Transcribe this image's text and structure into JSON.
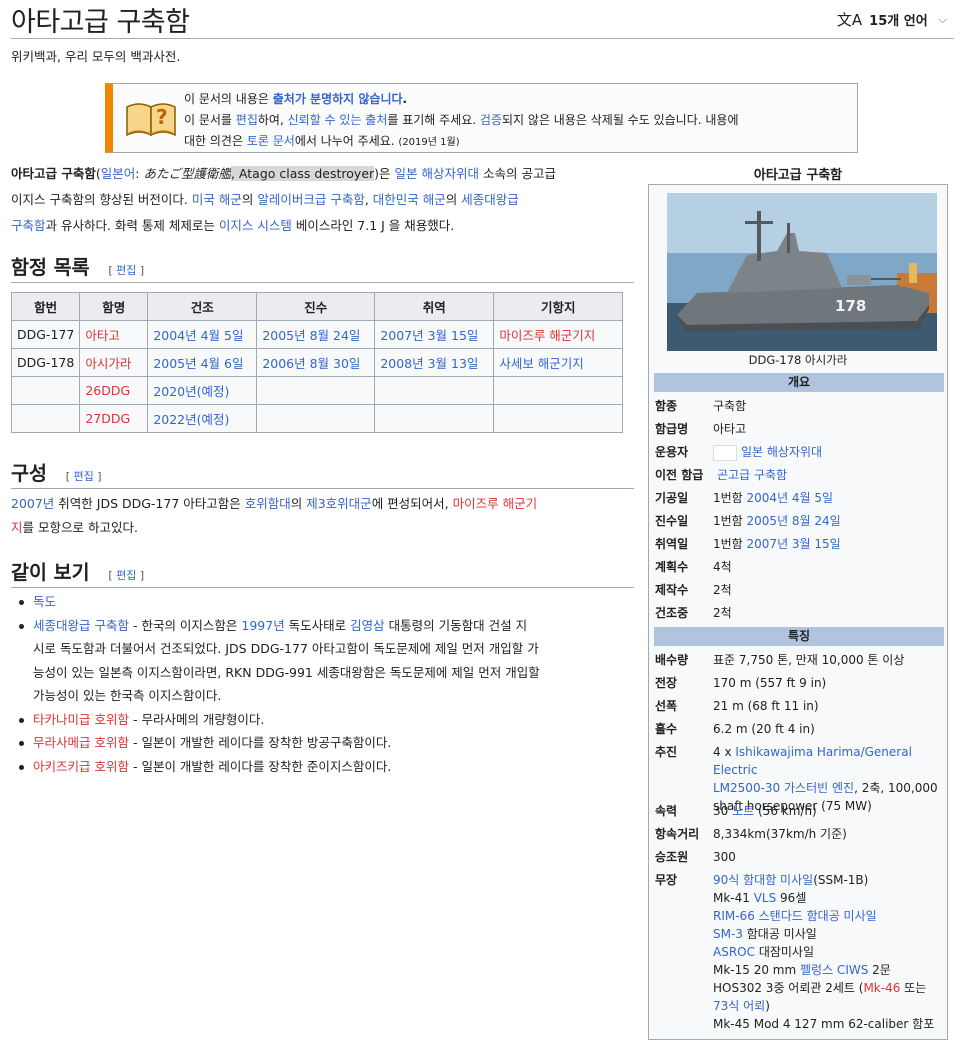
{
  "header": {
    "title": "아타고급 구축함",
    "lang_label": "15개 언어",
    "subtitle": "위키백과, 우리 모두의 백과사전."
  },
  "ambox": {
    "l1_pre": "이 문서의 내용은 ",
    "l1_link": "출처가 분명하지 않습니다",
    "l1_post": ".",
    "l2_a": "이 문서를 ",
    "l2_b": "편집",
    "l2_c": "하여, ",
    "l2_d": "신뢰할 수 있는 출처",
    "l2_e": "를 표기해 주세요. ",
    "l2_f": "검증",
    "l2_g": "되지 않은 내용은 삭제될 수도 있습니다. 내용에",
    "l3_a": "대한 의견은 ",
    "l3_b": "토론 문서",
    "l3_c": "에서 나누어 주세요. ",
    "l3_date": "(2019년 1월)"
  },
  "intro": {
    "bold": "아타고급 구축함",
    "p1": "(",
    "jp_link": "일본어",
    "p2": ": ",
    "jp_name": "あたご型護衛艦",
    "p3": ", ",
    "en_name": "Atago class destroyer",
    "p4": ")은 ",
    "jmsdf": "일본 해상자위대",
    "p5": " 소속의 공고급",
    "p6": "이지스 구축함의 향상된 버전이다. ",
    "usn": "미국 해군",
    "p7": "의 ",
    "burke": "알레이버크급 구축함",
    "p8": ", ",
    "rokn": "대한민국 해군",
    "p9": "의 ",
    "sejong": "세종대왕급",
    "p10": "구축함",
    "p11": "과 유사하다. 화력 통제 체제로는 ",
    "aegis": "이지스 시스템",
    "p12": " 베이스라인 7.1 J 을 채용했다."
  },
  "sections": {
    "list_title": "함정 목록",
    "comp_title": "구성",
    "see_title": "같이 보기",
    "edit_label": "편집"
  },
  "table": {
    "headers": [
      "함번",
      "함명",
      "건조",
      "진수",
      "취역",
      "기항지"
    ],
    "rows": [
      [
        "DDG-177",
        "아타고",
        "2004년 4월 5일",
        "2005년 8월 24일",
        "2007년 3월 15일",
        "마이즈루 해군기지"
      ],
      [
        "DDG-178",
        "아시가라",
        "2005년 4월 6일",
        "2006년 8월 30일",
        "2008년 3월 13일",
        "사세보 해군기지"
      ],
      [
        "",
        "26DDG",
        "2020년(예정)",
        "",
        "",
        ""
      ],
      [
        "",
        "27DDG",
        "2022년(예정)",
        "",
        "",
        ""
      ]
    ]
  },
  "composition": {
    "y2007": "2007년",
    "t1": " 취역한 JDS DDG-177 아타고함은 ",
    "escort": "호위함대",
    "t2": "의 ",
    "third": "제3호위대군",
    "t3": "에 편성되어서, ",
    "maizuru_a": "마이즈루 해군기",
    "maizuru_b": "지",
    "t4": "를 모항으로 하고있다."
  },
  "see_also": {
    "dokdo": "독도",
    "sejong": "세종대왕급 구축함",
    "s1": " - 한국의 이지스함은 ",
    "y1997": "1997년",
    "s2": " 독도사태로 ",
    "kys": "김영삼",
    "s3": " 대통령의 기동함대 건설 지",
    "s4": "시로 독도함과 더불어서 건조되었다. JDS DDG-177 아타고함이 독도문제에 제일 먼저 개입할 가",
    "s5": "능성이 있는 일본측 이지스함이라면, RKN DDG-991 세종대왕함은 독도문제에 제일 먼저 개입할",
    "s6": "가능성이 있는 한국측 이지스함이다.",
    "takanami": "타카나미급 호위함",
    "takanami_d": " - 무라사메의 개량형이다.",
    "murasame": "무라사메급 호위함",
    "murasame_d": " - 일본이 개발한 레이다를 장착한 방공구축함이다.",
    "akizuki": "아키즈키급 호위함",
    "akizuki_d": " - 일본이 개발한 레이다를 장착한 준이지스함이다."
  },
  "infobox": {
    "title": "아타고급 구축함",
    "hull_number": "178",
    "caption": "DDG-178 아시가라",
    "sec_overview": "개요",
    "sec_features": "특징",
    "labels": {
      "type": "함종",
      "class_ship": "함급명",
      "operator": "운용자",
      "prev": "이전 함급",
      "laid": "기공일",
      "launched": "진수일",
      "commissioned": "취역일",
      "planned": "계획수",
      "built": "제작수",
      "building": "건조중",
      "displacement": "배수량",
      "length": "전장",
      "beam": "선폭",
      "draft": "흘수",
      "propulsion": "추진",
      "speed": "속력",
      "range": "항속거리",
      "crew": "승조원",
      "armament": "무장"
    },
    "values": {
      "type": "구축함",
      "class_ship": "아타고",
      "operator": "일본 해상자위대",
      "prev": "곤고급 구축함",
      "laid_pre": "1번함 ",
      "laid_link": "2004년 4월 5일",
      "launched_pre": "1번함 ",
      "launched_link": "2005년 8월 24일",
      "comm_pre": "1번함 ",
      "comm_link": "2007년 3월 15일",
      "planned": "4척",
      "built": "2척",
      "building": "2척",
      "displacement": "표준 7,750 톤, 만재 10,000 톤 이상",
      "length": "170 m (557 ft 9 in)",
      "beam": "21 m (68 ft 11 in)",
      "draft": "6.2 m (20 ft 4 in)",
      "prop_pre": "4 x ",
      "prop_link1": "Ishikawajima Harima/General Electric",
      "prop_link2": "LM2500-30 가스터빈 엔진",
      "prop_post": ", 2축, 100,000",
      "prop_l3": "shaft horsepower (75 MW)",
      "speed_pre": "30 ",
      "speed_link": "노트",
      "speed_post": " (56 km/h)",
      "range": "8,334km(37km/h 기준)",
      "crew": "300",
      "arm_1a": "90식 함대함 미사일",
      "arm_1b": "(SSM-1B)",
      "arm_2a": "Mk-41 ",
      "arm_2b": "VLS",
      "arm_2c": " 96셀",
      "arm_3": "RIM-66 스탠다드 함대공 미사일",
      "arm_4a": "SM-3",
      "arm_4b": " 함대공 미사일",
      "arm_5a": "ASROC",
      "arm_5b": " 대잠미사일",
      "arm_6a": "Mk-15 20 mm ",
      "arm_6b": "펠렁스 CIWS",
      "arm_6c": " 2문",
      "arm_7a": "HOS302 3중 어뢰관 2세트 (",
      "arm_7b": "Mk-46",
      "arm_7c": " 또는",
      "arm_8a": "73식 어뢰",
      "arm_8b": ")",
      "arm_9": "Mk-45 Mod 4 127 mm 62-caliber 함포"
    }
  }
}
